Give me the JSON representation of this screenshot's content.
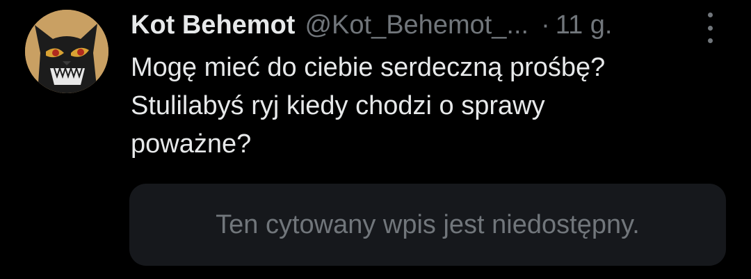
{
  "tweet": {
    "author_name": "Kot Behemot",
    "author_handle": "@Kot_Behemot_...",
    "separator": "·",
    "time": "11 g.",
    "avatar_icon": "black-cat-avatar",
    "more_icon": "more-vertical-icon",
    "text_lines": [
      "Mogę mieć do ciebie serdeczną prośbę?",
      "Stulilabyś ryj kiedy chodzi o sprawy",
      "poważne?"
    ],
    "quoted_unavailable": "Ten cytowany wpis jest niedostępny."
  },
  "colors": {
    "background": "#000000",
    "primary_text": "#e7e9ea",
    "secondary_text": "#71767b",
    "quote_background": "#16181c"
  }
}
